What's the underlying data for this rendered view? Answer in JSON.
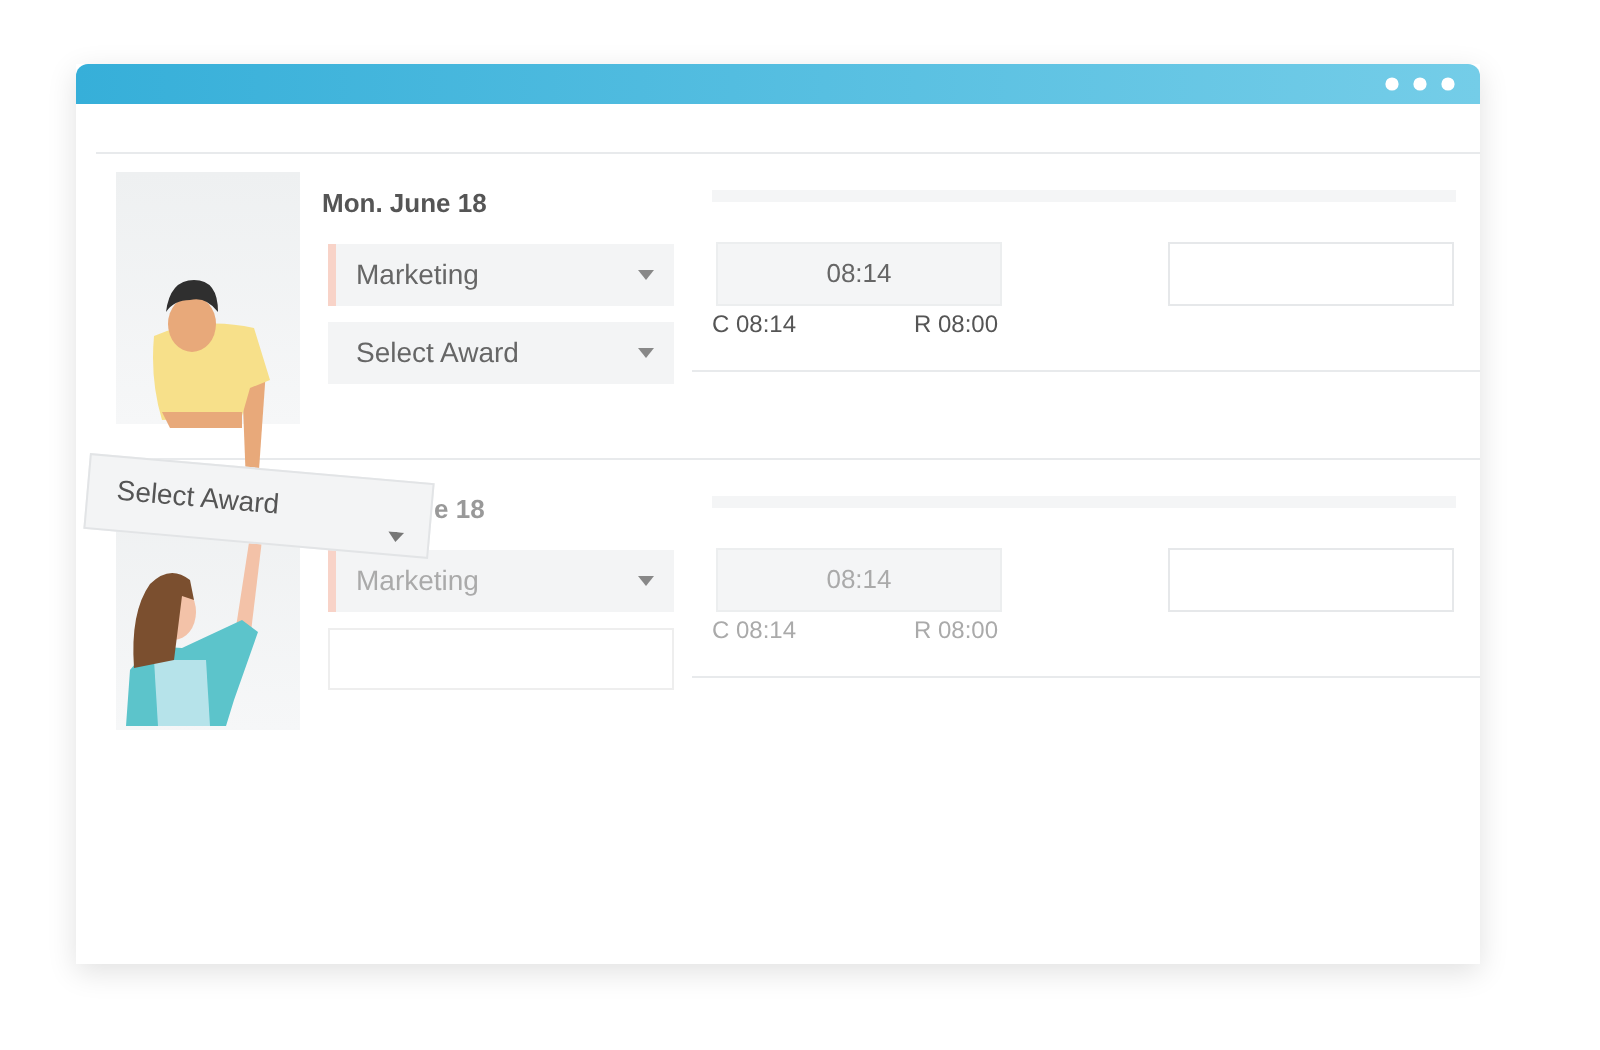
{
  "rows": [
    {
      "date": "Mon. June 18",
      "faded": false,
      "department": "Marketing",
      "award": {
        "kind": "select",
        "value": "Select Award"
      },
      "time": "08:14",
      "clock": "C 08:14",
      "rostered": "R 08:00"
    },
    {
      "date": "e 18",
      "faded": true,
      "department": "Marketing",
      "award": {
        "kind": "empty"
      },
      "time": "08:14",
      "clock": "C 08:14",
      "rostered": "R 08:00"
    }
  ],
  "floating_dropdown": {
    "value": "Select Award"
  }
}
